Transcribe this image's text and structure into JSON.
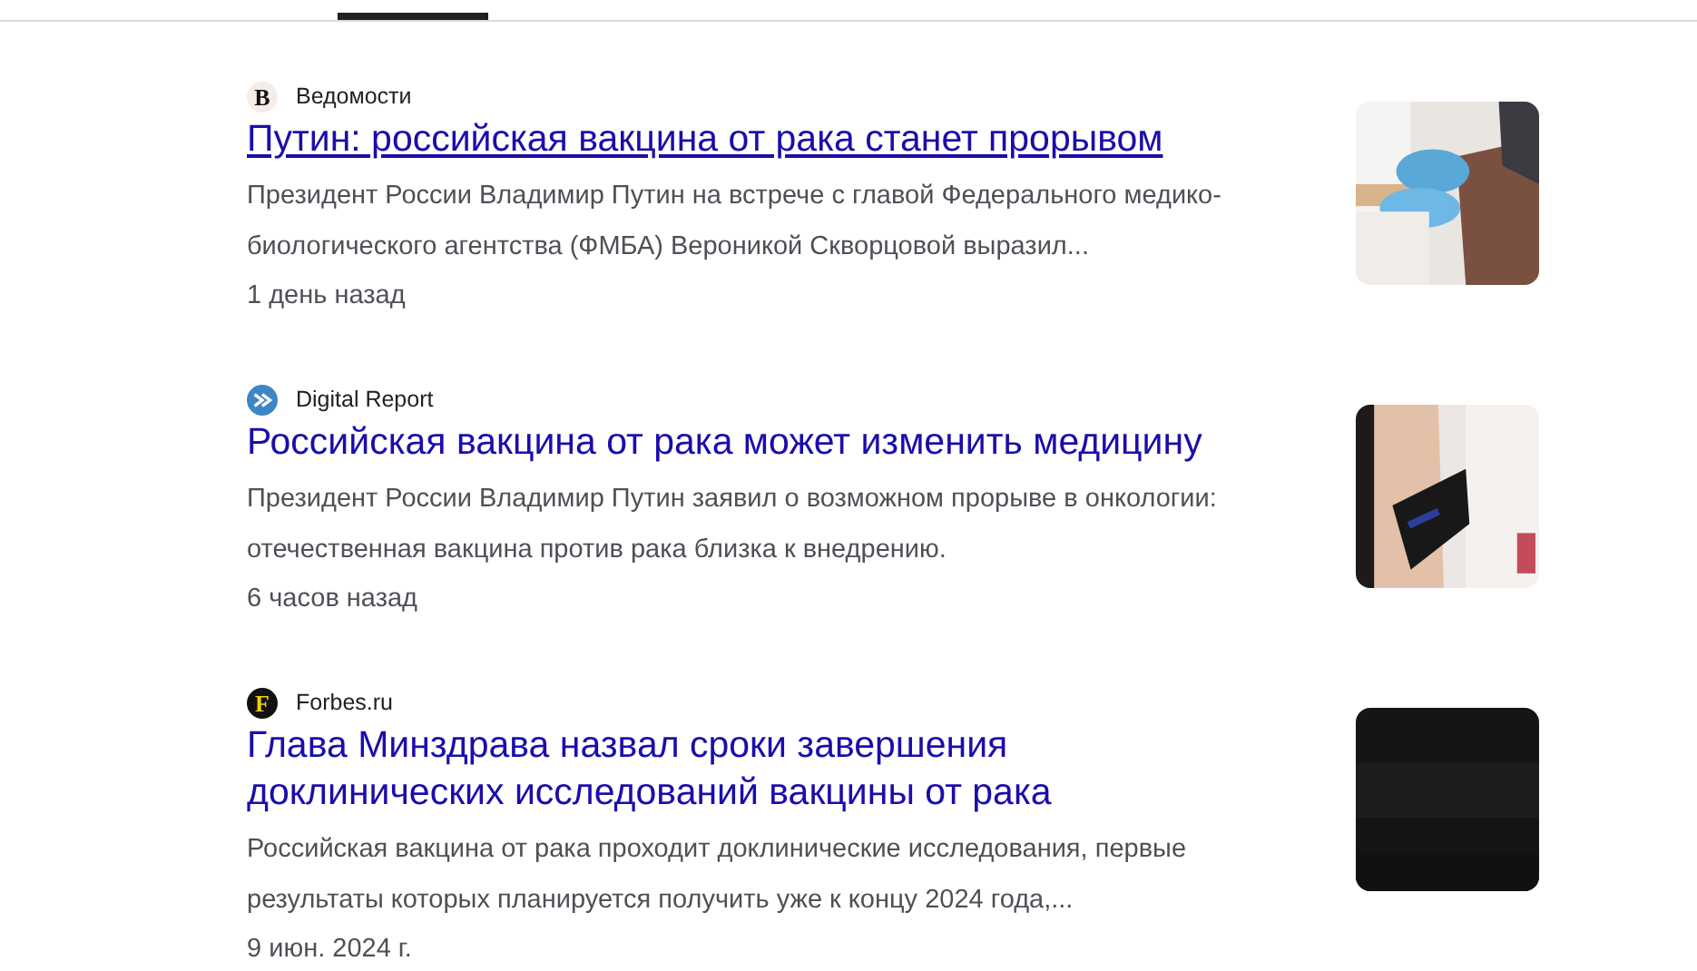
{
  "tabs_bar": {
    "active_indicator": true
  },
  "articles": [
    {
      "source": {
        "name": "Ведомости",
        "logo": {
          "kind": "letter",
          "text": "В",
          "color": "#f6ede8"
        }
      },
      "title": "Путин: российская вакцина от рака станет прорывом",
      "underlined": true,
      "snippet": "Президент России Владимир Путин на встрече с главой Федерального медико-биологического агентства (ФМБА) Вероникой Скворцовой выразил...",
      "time": "1 день назад"
    },
    {
      "source": {
        "name": "Digital Report",
        "logo": {
          "kind": "mark",
          "color": "#3d86c6"
        }
      },
      "title": "Российская вакцина от рака может изменить медицину",
      "underlined": false,
      "snippet": "Президент России Владимир Путин заявил о возможном прорыве в онкологии: отечественная вакцина против рака близка к внедрению.",
      "time": "6 часов назад"
    },
    {
      "source": {
        "name": "Forbes.ru",
        "logo": {
          "kind": "letter",
          "text": "F",
          "color": "#111111"
        }
      },
      "title": "Глава Минздрава назвал сроки завершения доклинических исследований вакцины от рака",
      "underlined": false,
      "snippet": "Российская вакцина от рака проходит доклинические исследования, первые результаты которых планируется получить уже к концу 2024 года,...",
      "time": "9 июн. 2024 г."
    }
  ]
}
